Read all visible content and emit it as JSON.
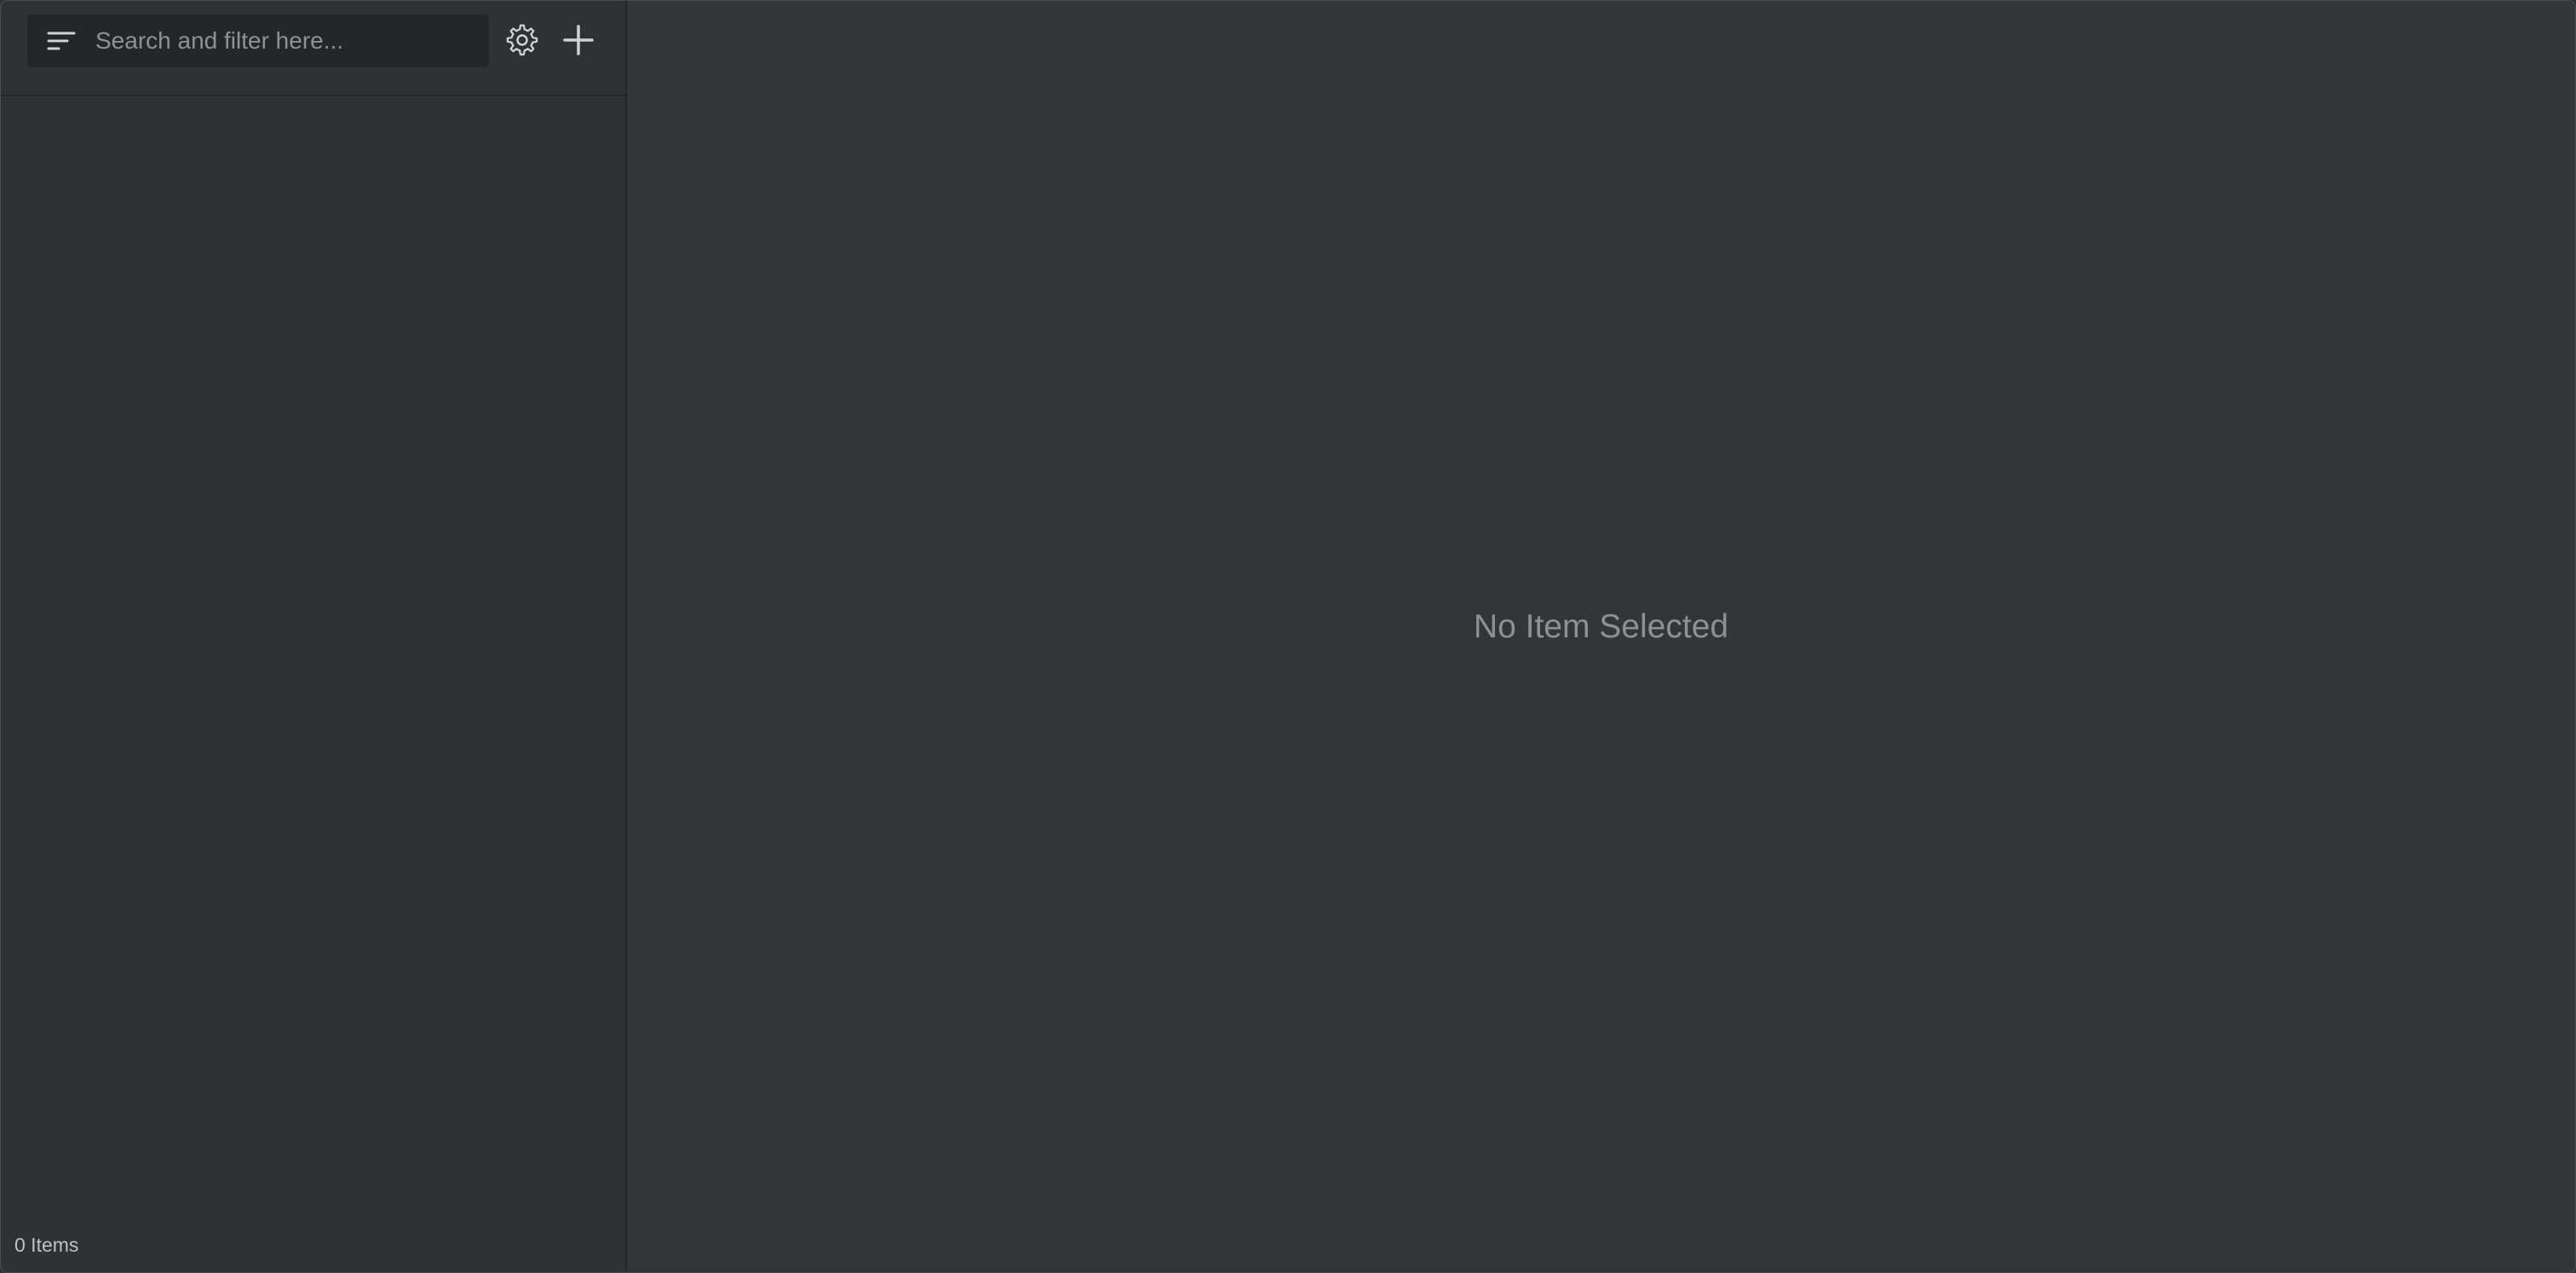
{
  "sidebar": {
    "search": {
      "placeholder": "Search and filter here...",
      "value": ""
    },
    "filter_icon": "sort-filter-icon",
    "settings_icon": "gear-icon",
    "add_icon": "plus-icon",
    "footer": {
      "item_count": "0 Items"
    }
  },
  "main": {
    "empty_state": "No Item Selected"
  },
  "colors": {
    "background": "#323538",
    "sidebar_background": "#2f3235",
    "search_background": "#24272a",
    "muted_text": "#8d9195",
    "icon_color": "#d0d3d6"
  }
}
